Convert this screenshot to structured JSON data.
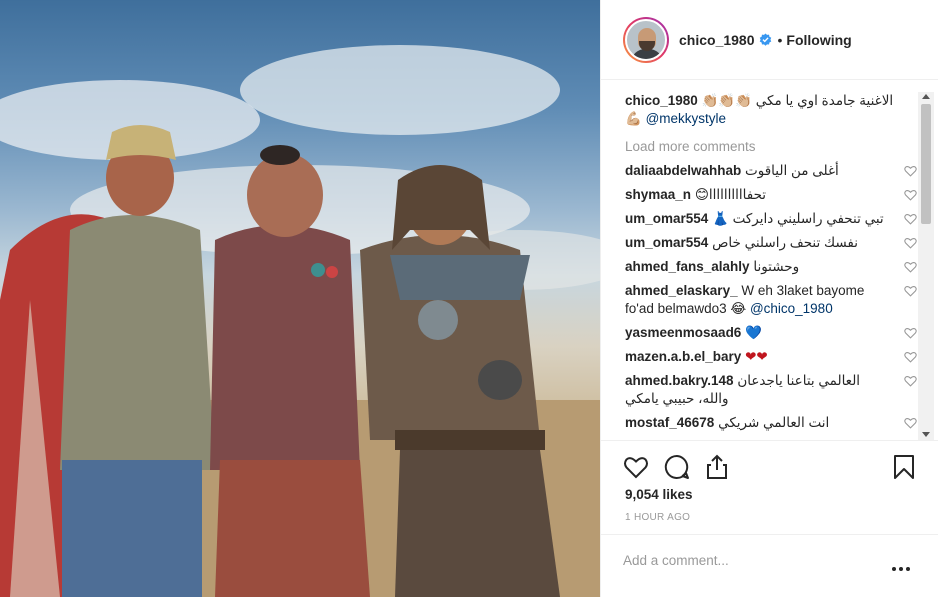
{
  "post": {
    "username": "chico_1980",
    "following_label": "Following",
    "caption_text": "الاغنية جامدة اوي يا مكي 👏🏼👏🏼👏🏼",
    "caption_emoji": "💪🏼",
    "caption_mention": "@mekkystyle",
    "load_more": "Load more comments",
    "likes": "9,054 likes",
    "time": "1 HOUR AGO",
    "comment_placeholder": "Add a comment..."
  },
  "comments": [
    {
      "user": "daliaabdelwahhab",
      "text": "أغلى من الياقوت"
    },
    {
      "user": "shymaa_n",
      "text": "تحفاااااااااا😊"
    },
    {
      "user": "um_omar554",
      "text": "تبي تنحفي راسليني دايركت 👗"
    },
    {
      "user": "um_omar554",
      "text": "نفسك تنحف راسلني خاص"
    },
    {
      "user": "ahmed_fans_alahly",
      "text": "وحشتونا"
    },
    {
      "user": "ahmed_elaskary_",
      "text": "W eh 3laket bayome fo'ad belmawdo3 😂",
      "mention": "@chico_1980"
    },
    {
      "user": "yasmeenmosaad6",
      "text": "💙"
    },
    {
      "user": "mazen.a.b.el_bary",
      "text": "❤❤"
    },
    {
      "user": "ahmed.bakry.148",
      "text": "العالمي بتاعنا ياجدعان والله، حبيبي يامكي"
    },
    {
      "user": "mostaf_46678",
      "text": "انت العالمي شريكي"
    }
  ],
  "icons": {
    "verified": "verified-badge-icon",
    "like": "heart-icon",
    "comment": "comment-bubble-icon",
    "share": "share-icon",
    "save": "bookmark-icon",
    "more": "more-options-icon"
  },
  "colors": {
    "text": "#262626",
    "muted": "#999999",
    "mention": "#003569",
    "verified": "#3897f0",
    "border": "#efefef"
  }
}
